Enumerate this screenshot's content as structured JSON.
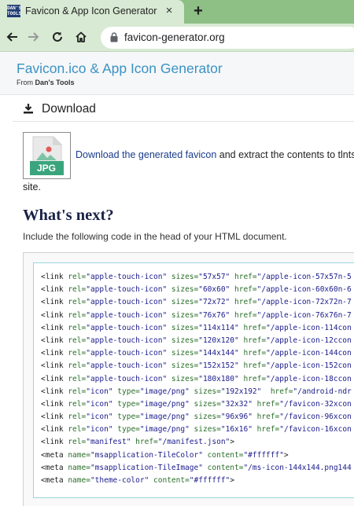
{
  "browser": {
    "favicon_text": "DAN'S TOOLS",
    "tab_title": "Favicon & App Icon Generator",
    "tab_close": "×",
    "new_tab": "+",
    "url": "favicon-generator.org"
  },
  "site": {
    "title": "Favicon.ico & App Icon Generator",
    "from_prefix": "From ",
    "from_name": "Dan's Tools"
  },
  "download": {
    "heading": "Download",
    "thumb_label": "JPG",
    "link_text": "Download the generated favicon",
    "text_after": " and extract the contents to tlnts",
    "text_wrap": "site."
  },
  "whats_next": {
    "heading": "What's next?",
    "instruction": "Include the following code in the head of your HTML document."
  },
  "code_lines": [
    [
      {
        "t": "tag",
        "v": "<link "
      },
      {
        "t": "attr",
        "v": "rel="
      },
      {
        "t": "val",
        "v": "\"apple-touch-icon\""
      },
      {
        "t": "tag",
        "v": " "
      },
      {
        "t": "attr",
        "v": "sizes="
      },
      {
        "t": "val",
        "v": "\"57x57\""
      },
      {
        "t": "tag",
        "v": " "
      },
      {
        "t": "attr",
        "v": "href="
      },
      {
        "t": "val",
        "v": "\"/apple-icon-57x57n-5"
      }
    ],
    [
      {
        "t": "tag",
        "v": "<link "
      },
      {
        "t": "attr",
        "v": "rel="
      },
      {
        "t": "val",
        "v": "\"apple-touch-icon\""
      },
      {
        "t": "tag",
        "v": " "
      },
      {
        "t": "attr",
        "v": "sizes="
      },
      {
        "t": "val",
        "v": "\"60x60\""
      },
      {
        "t": "tag",
        "v": " "
      },
      {
        "t": "attr",
        "v": "href="
      },
      {
        "t": "val",
        "v": "\"/apple-icon-60x60n-6"
      }
    ],
    [
      {
        "t": "tag",
        "v": "<link "
      },
      {
        "t": "attr",
        "v": "rel="
      },
      {
        "t": "val",
        "v": "\"apple-touch-icon\""
      },
      {
        "t": "tag",
        "v": " "
      },
      {
        "t": "attr",
        "v": "sizes="
      },
      {
        "t": "val",
        "v": "\"72x72\""
      },
      {
        "t": "tag",
        "v": " "
      },
      {
        "t": "attr",
        "v": "href="
      },
      {
        "t": "val",
        "v": "\"/apple-icon-72x72n-7"
      }
    ],
    [
      {
        "t": "tag",
        "v": "<link "
      },
      {
        "t": "attr",
        "v": "rel="
      },
      {
        "t": "val",
        "v": "\"apple-touch-icon\""
      },
      {
        "t": "tag",
        "v": " "
      },
      {
        "t": "attr",
        "v": "sizes="
      },
      {
        "t": "val",
        "v": "\"76x76\""
      },
      {
        "t": "tag",
        "v": " "
      },
      {
        "t": "attr",
        "v": "href="
      },
      {
        "t": "val",
        "v": "\"/apple-icon-76x76n-7"
      }
    ],
    [
      {
        "t": "tag",
        "v": "<link "
      },
      {
        "t": "attr",
        "v": "rel="
      },
      {
        "t": "val",
        "v": "\"apple-touch-icon\""
      },
      {
        "t": "tag",
        "v": " "
      },
      {
        "t": "attr",
        "v": "sizes="
      },
      {
        "t": "val",
        "v": "\"114x114\""
      },
      {
        "t": "tag",
        "v": " "
      },
      {
        "t": "attr",
        "v": "href="
      },
      {
        "t": "val",
        "v": "\"/apple-icon-114con"
      }
    ],
    [
      {
        "t": "tag",
        "v": "<link "
      },
      {
        "t": "attr",
        "v": "rel="
      },
      {
        "t": "val",
        "v": "\"apple-touch-icon\""
      },
      {
        "t": "tag",
        "v": " "
      },
      {
        "t": "attr",
        "v": "sizes="
      },
      {
        "t": "val",
        "v": "\"120x120\""
      },
      {
        "t": "tag",
        "v": " "
      },
      {
        "t": "attr",
        "v": "href="
      },
      {
        "t": "val",
        "v": "\"/apple-icon-12ccon"
      }
    ],
    [
      {
        "t": "tag",
        "v": "<link "
      },
      {
        "t": "attr",
        "v": "rel="
      },
      {
        "t": "val",
        "v": "\"apple-touch-icon\""
      },
      {
        "t": "tag",
        "v": " "
      },
      {
        "t": "attr",
        "v": "sizes="
      },
      {
        "t": "val",
        "v": "\"144x144\""
      },
      {
        "t": "tag",
        "v": " "
      },
      {
        "t": "attr",
        "v": "href="
      },
      {
        "t": "val",
        "v": "\"/apple-icon-144con"
      }
    ],
    [
      {
        "t": "tag",
        "v": "<link "
      },
      {
        "t": "attr",
        "v": "rel="
      },
      {
        "t": "val",
        "v": "\"apple-touch-icon\""
      },
      {
        "t": "tag",
        "v": " "
      },
      {
        "t": "attr",
        "v": "sizes="
      },
      {
        "t": "val",
        "v": "\"152x152\""
      },
      {
        "t": "tag",
        "v": " "
      },
      {
        "t": "attr",
        "v": "href="
      },
      {
        "t": "val",
        "v": "\"/apple-icon-152con"
      }
    ],
    [
      {
        "t": "tag",
        "v": "<link "
      },
      {
        "t": "attr",
        "v": "rel="
      },
      {
        "t": "val",
        "v": "\"apple-touch-icon\""
      },
      {
        "t": "tag",
        "v": " "
      },
      {
        "t": "attr",
        "v": "sizes="
      },
      {
        "t": "val",
        "v": "\"180x180\""
      },
      {
        "t": "tag",
        "v": " "
      },
      {
        "t": "attr",
        "v": "href="
      },
      {
        "t": "val",
        "v": "\"/apple-icon-18ccon"
      }
    ],
    [
      {
        "t": "tag",
        "v": "<link "
      },
      {
        "t": "attr",
        "v": "rel="
      },
      {
        "t": "val",
        "v": "\"icon\""
      },
      {
        "t": "tag",
        "v": " "
      },
      {
        "t": "attr",
        "v": "type="
      },
      {
        "t": "val",
        "v": "\"image/png\""
      },
      {
        "t": "tag",
        "v": " "
      },
      {
        "t": "attr",
        "v": "sizes="
      },
      {
        "t": "val",
        "v": "\"192x192\""
      },
      {
        "t": "tag",
        "v": "  "
      },
      {
        "t": "attr",
        "v": "href="
      },
      {
        "t": "val",
        "v": "\"/android-ndr"
      }
    ],
    [
      {
        "t": "tag",
        "v": "<link "
      },
      {
        "t": "attr",
        "v": "rel="
      },
      {
        "t": "val",
        "v": "\"icon\""
      },
      {
        "t": "tag",
        "v": " "
      },
      {
        "t": "attr",
        "v": "type="
      },
      {
        "t": "val",
        "v": "\"image/png\""
      },
      {
        "t": "tag",
        "v": " "
      },
      {
        "t": "attr",
        "v": "sizes="
      },
      {
        "t": "val",
        "v": "\"32x32\""
      },
      {
        "t": "tag",
        "v": " "
      },
      {
        "t": "attr",
        "v": "href="
      },
      {
        "t": "val",
        "v": "\"/favicon-32xcon"
      }
    ],
    [
      {
        "t": "tag",
        "v": "<link "
      },
      {
        "t": "attr",
        "v": "rel="
      },
      {
        "t": "val",
        "v": "\"icon\""
      },
      {
        "t": "tag",
        "v": " "
      },
      {
        "t": "attr",
        "v": "type="
      },
      {
        "t": "val",
        "v": "\"image/png\""
      },
      {
        "t": "tag",
        "v": " "
      },
      {
        "t": "attr",
        "v": "sizes="
      },
      {
        "t": "val",
        "v": "\"96x96\""
      },
      {
        "t": "tag",
        "v": " "
      },
      {
        "t": "attr",
        "v": "href="
      },
      {
        "t": "val",
        "v": "\"/favicon-96xcon"
      }
    ],
    [
      {
        "t": "tag",
        "v": "<link "
      },
      {
        "t": "attr",
        "v": "rel="
      },
      {
        "t": "val",
        "v": "\"icon\""
      },
      {
        "t": "tag",
        "v": " "
      },
      {
        "t": "attr",
        "v": "type="
      },
      {
        "t": "val",
        "v": "\"image/png\""
      },
      {
        "t": "tag",
        "v": " "
      },
      {
        "t": "attr",
        "v": "sizes="
      },
      {
        "t": "val",
        "v": "\"16x16\""
      },
      {
        "t": "tag",
        "v": " "
      },
      {
        "t": "attr",
        "v": "href="
      },
      {
        "t": "val",
        "v": "\"/favicon-16xcon"
      }
    ],
    [
      {
        "t": "tag",
        "v": "<link "
      },
      {
        "t": "attr",
        "v": "rel="
      },
      {
        "t": "val",
        "v": "\"manifest\""
      },
      {
        "t": "tag",
        "v": " "
      },
      {
        "t": "attr",
        "v": "href="
      },
      {
        "t": "val",
        "v": "\"/manifest.json\""
      },
      {
        "t": "tag",
        "v": ">"
      }
    ],
    [
      {
        "t": "tag",
        "v": "<meta "
      },
      {
        "t": "attr",
        "v": "name="
      },
      {
        "t": "val",
        "v": "\"msapplication-TileColor\""
      },
      {
        "t": "tag",
        "v": " "
      },
      {
        "t": "attr",
        "v": "content="
      },
      {
        "t": "val",
        "v": "\"#ffffff\""
      },
      {
        "t": "tag",
        "v": ">"
      }
    ],
    [
      {
        "t": "tag",
        "v": "<meta "
      },
      {
        "t": "attr",
        "v": "name="
      },
      {
        "t": "val",
        "v": "\"msapplication-TileImage\""
      },
      {
        "t": "tag",
        "v": " "
      },
      {
        "t": "attr",
        "v": "content="
      },
      {
        "t": "val",
        "v": "\"/ms-icon-144x144.png144"
      }
    ],
    [
      {
        "t": "tag",
        "v": "<meta "
      },
      {
        "t": "attr",
        "v": "name="
      },
      {
        "t": "val",
        "v": "\"theme-color\""
      },
      {
        "t": "tag",
        "v": " "
      },
      {
        "t": "attr",
        "v": "content="
      },
      {
        "t": "val",
        "v": "\"#ffffff\""
      },
      {
        "t": "tag",
        "v": ">"
      }
    ]
  ],
  "colors": {
    "tab_strip": "#8ebf85",
    "toolbar": "#d8ead3",
    "site_title": "#3a92c6",
    "heading": "#1a2348",
    "link": "#1a3c8c",
    "code_border": "#9bd5df"
  },
  "icons": {
    "back": "arrow-left-icon",
    "forward": "arrow-right-icon",
    "reload": "reload-icon",
    "home": "home-icon",
    "lock": "lock-icon",
    "download": "download-icon",
    "thumb": "jpg-file-icon"
  }
}
